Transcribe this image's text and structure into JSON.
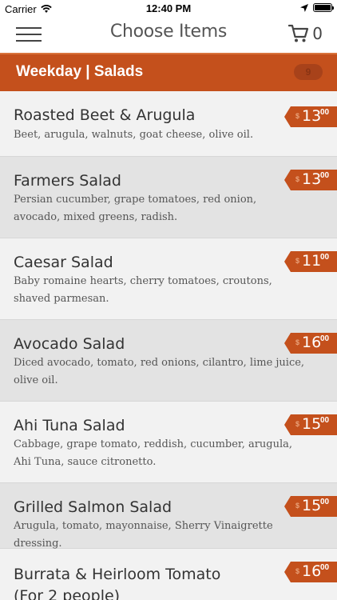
{
  "status_bar": {
    "carrier": "Carrier",
    "time": "12:40 PM"
  },
  "nav": {
    "title": "Choose Items",
    "cart_count": "0"
  },
  "category": {
    "title": "Weekday | Salads",
    "count": "9"
  },
  "items": [
    {
      "name": "Roasted Beet & Arugula",
      "description": "Beet, arugula, walnuts, goat cheese, olive oil.",
      "price_currency": "$",
      "price_whole": "13",
      "price_cents": "00"
    },
    {
      "name": "Farmers Salad",
      "description": "Persian cucumber, grape tomatoes, red onion, avocado, mixed greens, radish.",
      "price_currency": "$",
      "price_whole": "13",
      "price_cents": "00"
    },
    {
      "name": "Caesar Salad",
      "description": "Baby romaine hearts, cherry tomatoes, croutons, shaved parmesan.",
      "price_currency": "$",
      "price_whole": "11",
      "price_cents": "00"
    },
    {
      "name": "Avocado Salad",
      "description": "Diced avocado, tomato, red onions, cilantro, lime juice, olive oil.",
      "price_currency": "$",
      "price_whole": "16",
      "price_cents": "00"
    },
    {
      "name": "Ahi Tuna Salad",
      "description": "Cabbage, grape tomato, reddish, cucumber, arugula, Ahi Tuna, sauce citronetto.",
      "price_currency": "$",
      "price_whole": "15",
      "price_cents": "00"
    },
    {
      "name": "Grilled Salmon Salad",
      "description": "Arugula, tomato, mayonnaise, Sherry Vinaigrette dressing.",
      "price_currency": "$",
      "price_whole": "15",
      "price_cents": "00"
    },
    {
      "name": "Burrata & Heirloom Tomato (For 2 people)",
      "description": "",
      "price_currency": "$",
      "price_whole": "16",
      "price_cents": "00"
    }
  ],
  "colors": {
    "accent": "#c4501c",
    "row_alt": "#e3e3e3"
  }
}
